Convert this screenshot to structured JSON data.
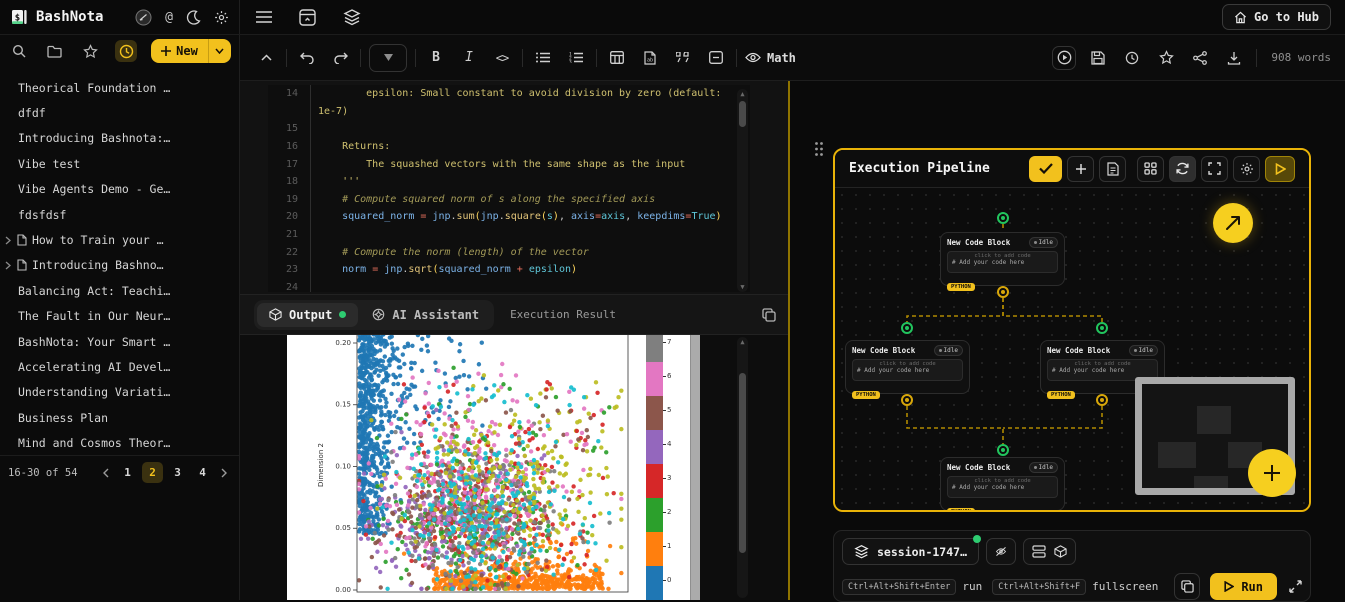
{
  "app": {
    "name": "BashNota",
    "accent": "#f2c11d"
  },
  "topbar": {
    "go_to_hub": "Go to Hub"
  },
  "sidebar": {
    "new_label": "New",
    "items": [
      {
        "label": "Theorical Foundation …",
        "has_icon": false
      },
      {
        "label": "dfdf",
        "has_icon": false
      },
      {
        "label": "Introducing Bashnota:…",
        "has_icon": false
      },
      {
        "label": "Vibe test",
        "has_icon": false
      },
      {
        "label": "Vibe Agents Demo - Ge…",
        "has_icon": false
      },
      {
        "label": "fdsfdsf",
        "has_icon": false
      },
      {
        "label": "How to Train your …",
        "has_icon": true
      },
      {
        "label": "Introducing Bashno…",
        "has_icon": true
      },
      {
        "label": "Balancing Act: Teachi…",
        "has_icon": false
      },
      {
        "label": "The Fault in Our Neur…",
        "has_icon": false
      },
      {
        "label": "BashNota: Your Smart …",
        "has_icon": false
      },
      {
        "label": "Accelerating AI Devel…",
        "has_icon": false
      },
      {
        "label": "Understanding Variati…",
        "has_icon": false
      },
      {
        "label": "Business Plan",
        "has_icon": false
      },
      {
        "label": "Mind and Cosmos Theor…",
        "has_icon": false
      }
    ],
    "pagination": {
      "range": "16-30 of 54",
      "pages": [
        "1",
        "2",
        "3",
        "4"
      ],
      "active": "2"
    }
  },
  "toolbar": {
    "math_label": "Math",
    "word_count": "908 words"
  },
  "editor": {
    "lines": [
      {
        "n": "14",
        "seg": [
          [
            "d",
            "        epsilon: Small constant to avoid division by zero (default:"
          ]
        ]
      },
      {
        "n": "",
        "seg": [
          [
            "d",
            "1e-7)"
          ]
        ]
      },
      {
        "n": "15",
        "seg": []
      },
      {
        "n": "16",
        "seg": [
          [
            "d",
            "    Returns:"
          ]
        ]
      },
      {
        "n": "17",
        "seg": [
          [
            "d",
            "        The squashed vectors with the same shape as the input"
          ]
        ]
      },
      {
        "n": "18",
        "seg": [
          [
            "d",
            "    '''"
          ]
        ]
      },
      {
        "n": "19",
        "seg": [
          [
            "m",
            "    # Compute squared norm of s along the specified axis"
          ]
        ]
      },
      {
        "n": "20",
        "seg": [
          [
            "t",
            "    "
          ],
          [
            "v",
            "squared_norm"
          ],
          [
            "t",
            " "
          ],
          [
            "o",
            "="
          ],
          [
            "t",
            " "
          ],
          [
            "v",
            "jnp"
          ],
          [
            "t",
            "."
          ],
          [
            "f",
            "sum"
          ],
          [
            "p",
            "("
          ],
          [
            "v",
            "jnp"
          ],
          [
            "t",
            "."
          ],
          [
            "f",
            "square"
          ],
          [
            "p",
            "("
          ],
          [
            "c",
            "s"
          ],
          [
            "p",
            ")"
          ],
          [
            "t",
            ", "
          ],
          [
            "v",
            "axis"
          ],
          [
            "o",
            "="
          ],
          [
            "c",
            "axis"
          ],
          [
            "t",
            ", "
          ],
          [
            "v",
            "keepdims"
          ],
          [
            "o",
            "="
          ],
          [
            "c",
            "True"
          ],
          [
            "p",
            ")"
          ]
        ]
      },
      {
        "n": "21",
        "seg": []
      },
      {
        "n": "22",
        "seg": [
          [
            "m",
            "    # Compute the norm (length) of the vector"
          ]
        ]
      },
      {
        "n": "23",
        "seg": [
          [
            "t",
            "    "
          ],
          [
            "v",
            "norm"
          ],
          [
            "t",
            " "
          ],
          [
            "o",
            "="
          ],
          [
            "t",
            " "
          ],
          [
            "v",
            "jnp"
          ],
          [
            "t",
            "."
          ],
          [
            "f",
            "sqrt"
          ],
          [
            "p",
            "("
          ],
          [
            "v",
            "squared_norm"
          ],
          [
            "t",
            " "
          ],
          [
            "o",
            "+"
          ],
          [
            "t",
            " "
          ],
          [
            "c",
            "epsilon"
          ],
          [
            "p",
            ")"
          ]
        ]
      },
      {
        "n": "24",
        "seg": []
      }
    ]
  },
  "output": {
    "tabs": [
      {
        "label": "Output",
        "active": true
      },
      {
        "label": "AI Assistant",
        "active": false
      },
      {
        "label": "Execution Result",
        "active": false
      }
    ]
  },
  "chart_data": {
    "type": "scatter",
    "title": "",
    "xlabel": "",
    "ylabel": "Dimension 2",
    "yticks": [
      "0.00",
      "0.05",
      "0.10",
      "0.15",
      "0.20"
    ],
    "ylim": [
      0,
      0.21
    ],
    "grid": false,
    "legend_position": "colorbar-right",
    "colorbar": {
      "labels": [
        "7",
        "6",
        "5",
        "4",
        "3",
        "2",
        "1",
        "0"
      ],
      "colors": [
        "#7f7f7f",
        "#e377c2",
        "#8c564b",
        "#9467bd",
        "#d62728",
        "#2ca02c",
        "#ff7f0e",
        "#1f77b4"
      ]
    },
    "palette": [
      "#1f77b4",
      "#ff7f0e",
      "#2ca02c",
      "#d62728",
      "#9467bd",
      "#8c564b",
      "#e377c2",
      "#7f7f7f",
      "#bcbd22",
      "#17becf"
    ],
    "clusters": [
      {
        "c": 0,
        "n": 520,
        "x": {
          "d": "halfgauss",
          "a": 0,
          "b": 0.05
        },
        "y": {
          "d": "uniform",
          "a": 0.045,
          "b": 0.215
        }
      },
      {
        "c": 0,
        "n": 160,
        "x": {
          "d": "halfgauss",
          "a": 0,
          "b": 0.12
        },
        "y": {
          "d": "uniform",
          "a": 0.1,
          "b": 0.21
        }
      },
      {
        "c": 0,
        "n": 60,
        "x": {
          "d": "uniform",
          "a": 0.05,
          "b": 0.48
        },
        "y": {
          "d": "uniform",
          "a": 0.13,
          "b": 0.21
        }
      },
      {
        "c": 1,
        "n": 470,
        "x": {
          "d": "uniform",
          "a": 0.28,
          "b": 0.92
        },
        "y": {
          "d": "halfgauss",
          "a": 0,
          "b": 0.009
        }
      },
      {
        "c": 1,
        "n": 130,
        "x": {
          "d": "gauss",
          "a": 0.62,
          "b": 0.15
        },
        "y": {
          "d": "halfgauss",
          "a": 0,
          "b": 0.028
        }
      },
      {
        "c": 2,
        "n": 210,
        "x": {
          "d": "gauss",
          "a": 0.42,
          "b": 0.17
        },
        "y": {
          "d": "gauss",
          "a": 0.055,
          "b": 0.028
        }
      },
      {
        "c": 3,
        "n": 220,
        "x": {
          "d": "gauss",
          "a": 0.5,
          "b": 0.18
        },
        "y": {
          "d": "gauss",
          "a": 0.068,
          "b": 0.03
        }
      },
      {
        "c": 4,
        "n": 200,
        "x": {
          "d": "gauss",
          "a": 0.34,
          "b": 0.15
        },
        "y": {
          "d": "gauss",
          "a": 0.058,
          "b": 0.028
        }
      },
      {
        "c": 5,
        "n": 190,
        "x": {
          "d": "gauss",
          "a": 0.38,
          "b": 0.16
        },
        "y": {
          "d": "gauss",
          "a": 0.052,
          "b": 0.026
        }
      },
      {
        "c": 6,
        "n": 230,
        "x": {
          "d": "gauss",
          "a": 0.42,
          "b": 0.18
        },
        "y": {
          "d": "gauss",
          "a": 0.085,
          "b": 0.032
        }
      },
      {
        "c": 7,
        "n": 200,
        "x": {
          "d": "gauss",
          "a": 0.44,
          "b": 0.17
        },
        "y": {
          "d": "gauss",
          "a": 0.062,
          "b": 0.028
        }
      },
      {
        "c": 8,
        "n": 230,
        "x": {
          "d": "gauss",
          "a": 0.57,
          "b": 0.2
        },
        "y": {
          "d": "gauss",
          "a": 0.08,
          "b": 0.034
        }
      },
      {
        "c": 9,
        "n": 220,
        "x": {
          "d": "gauss",
          "a": 0.46,
          "b": 0.18
        },
        "y": {
          "d": "gauss",
          "a": 0.068,
          "b": 0.03
        }
      },
      {
        "c": 2,
        "n": 26,
        "x": {
          "d": "uniform",
          "a": 0.15,
          "b": 0.95
        },
        "y": {
          "d": "uniform",
          "a": 0.1,
          "b": 0.18
        }
      },
      {
        "c": 3,
        "n": 26,
        "x": {
          "d": "uniform",
          "a": 0.15,
          "b": 0.95
        },
        "y": {
          "d": "uniform",
          "a": 0.1,
          "b": 0.18
        }
      },
      {
        "c": 5,
        "n": 20,
        "x": {
          "d": "uniform",
          "a": 0.15,
          "b": 0.9
        },
        "y": {
          "d": "uniform",
          "a": 0.1,
          "b": 0.16
        }
      },
      {
        "c": 6,
        "n": 26,
        "x": {
          "d": "uniform",
          "a": 0.15,
          "b": 0.95
        },
        "y": {
          "d": "uniform",
          "a": 0.1,
          "b": 0.18
        }
      },
      {
        "c": 8,
        "n": 30,
        "x": {
          "d": "uniform",
          "a": 0.25,
          "b": 0.98
        },
        "y": {
          "d": "uniform",
          "a": 0.09,
          "b": 0.175
        }
      },
      {
        "c": 9,
        "n": 24,
        "x": {
          "d": "uniform",
          "a": 0.2,
          "b": 0.9
        },
        "y": {
          "d": "uniform",
          "a": 0.1,
          "b": 0.17
        }
      }
    ]
  },
  "pipeline": {
    "title": "Execution Pipeline",
    "node": {
      "title": "New Code Block",
      "status": "Idle",
      "hint": "click to add code",
      "placeholder": "# Add your code here",
      "lang": "PYTHON"
    }
  },
  "session": {
    "name": "session-1747…",
    "run_label": "Run",
    "shortcuts": [
      {
        "keys": "Ctrl+Alt+Shift+Enter",
        "label": "run"
      },
      {
        "keys": "Ctrl+Alt+Shift+F",
        "label": "fullscreen"
      }
    ]
  }
}
